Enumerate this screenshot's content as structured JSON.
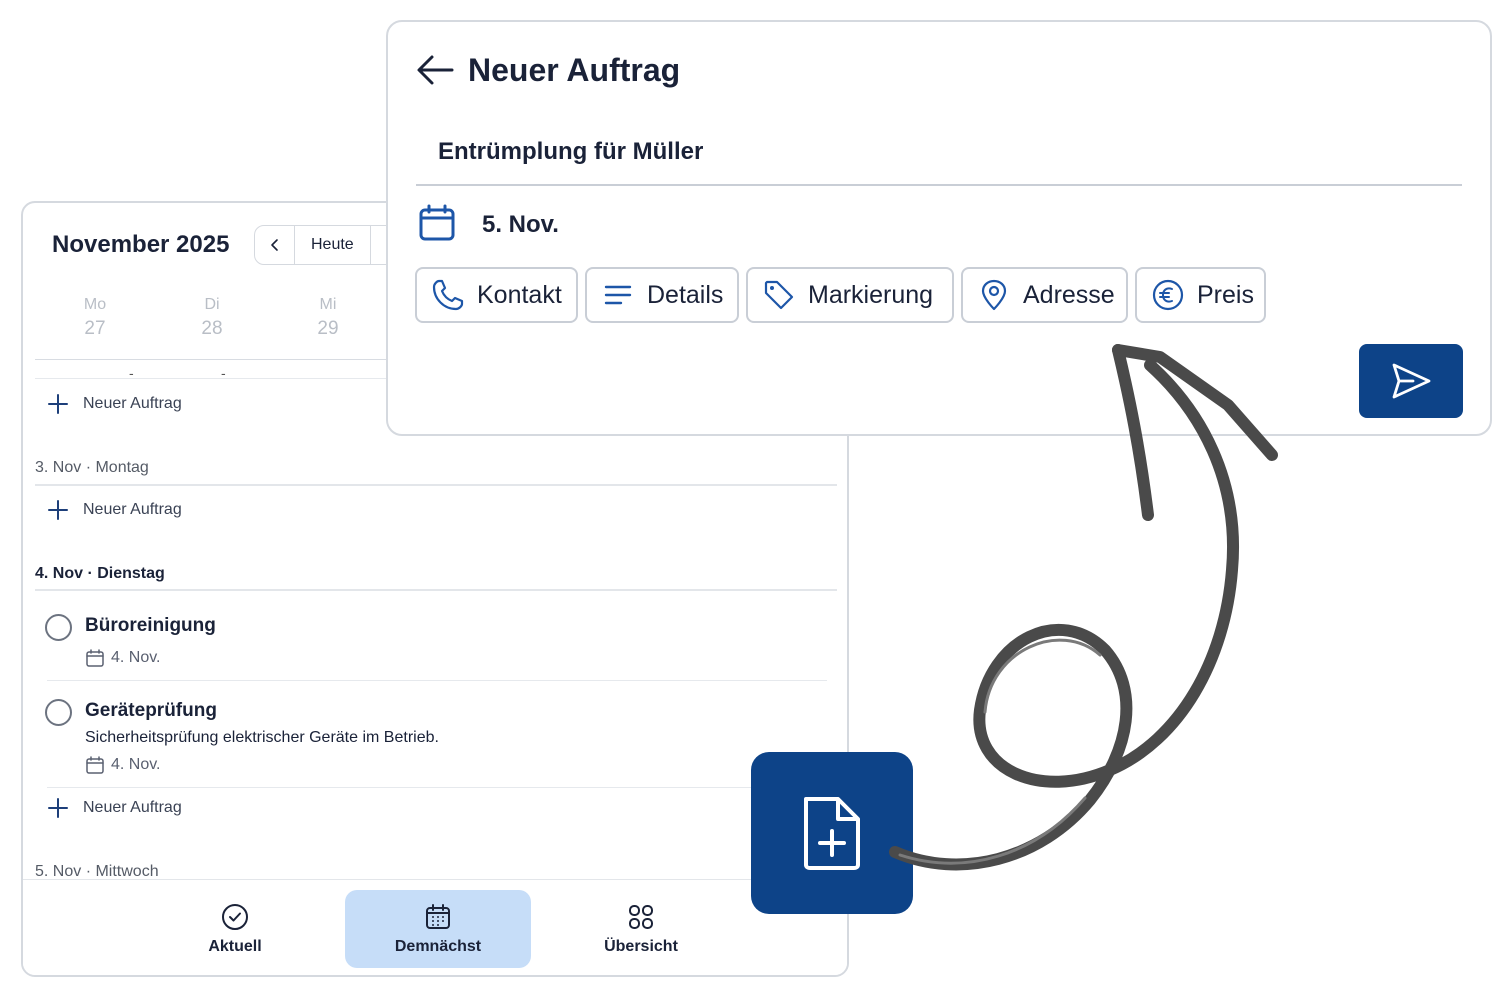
{
  "calendar": {
    "month_title": "November 2025",
    "today_label": "Heute",
    "weekdays": [
      {
        "name": "Mo",
        "day": "27"
      },
      {
        "name": "Di",
        "day": "28"
      },
      {
        "name": "Mi",
        "day": "29"
      }
    ],
    "week_dashes": [
      "-",
      "-"
    ],
    "add_label": "Neuer Auftrag",
    "sections": [
      {
        "heading": "3. Nov · Montag"
      },
      {
        "heading": "4. Nov · Dienstag"
      },
      {
        "heading": "5. Nov · Mittwoch"
      }
    ],
    "tasks": [
      {
        "title": "Büroreinigung",
        "description": "",
        "date": "4. Nov."
      },
      {
        "title": "Geräteprüfung",
        "description": "Sicherheitsprüfung elektrischer Geräte im Betrieb.",
        "date": "4. Nov."
      }
    ]
  },
  "bottom_nav": {
    "items": [
      {
        "label": "Aktuell",
        "icon": "check-circle-icon",
        "active": false
      },
      {
        "label": "Demnächst",
        "icon": "calendar-icon",
        "active": true
      },
      {
        "label": "Übersicht",
        "icon": "grid-icon",
        "active": false
      }
    ],
    "active_color": "#c6ddf8"
  },
  "order": {
    "title": "Neuer Auftrag",
    "name": "Entrümplung für Müller",
    "date": "5. Nov.",
    "chips": [
      {
        "label": "Kontakt",
        "icon": "phone-icon"
      },
      {
        "label": "Details",
        "icon": "lines-icon"
      },
      {
        "label": "Markierung",
        "icon": "tag-icon"
      },
      {
        "label": "Adresse",
        "icon": "location-pin-icon"
      },
      {
        "label": "Preis",
        "icon": "euro-icon"
      }
    ],
    "send_icon": "send-icon"
  },
  "fab": {
    "icon": "new-document-icon"
  },
  "colors": {
    "brand": "#0d4388",
    "text": "#1a2238",
    "muted": "#b9bec6",
    "arrow": "#4a4a4a"
  }
}
